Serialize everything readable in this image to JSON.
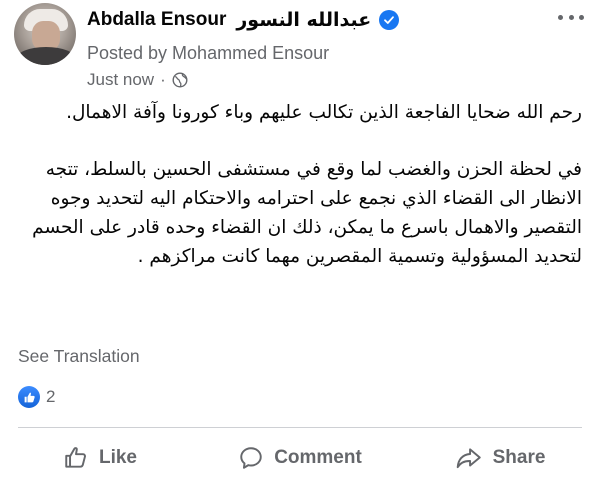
{
  "header": {
    "author_name": "Abdalla Ensour",
    "author_name_arabic": "عبدالله النسور",
    "posted_by": "Posted by Mohammed Ensour",
    "timestamp": "Just now",
    "separator": "·",
    "icons": {
      "verified": "verified-badge-icon",
      "more": "more-options-icon",
      "audience": "globe-icon"
    }
  },
  "post": {
    "paragraph1": "رحم الله ضحايا الفاجعة الذين تكالب عليهم وباء كورونا وآفة الاهمال.",
    "paragraph2": "في لحظة الحزن والغضب لما وقع في مستشفى الحسين بالسلط، تتجه الانظار الى القضاء الذي نجمع على احترامه والاحتكام اليه لتحديد وجوه التقصير والاهمال باسرع ما يمكن، ذلك ان القضاء وحده قادر على الحسم لتحديد المسؤولية وتسمية المقصرين مهما كانت مراكزهم ."
  },
  "see_translation": "See Translation",
  "reactions": {
    "count": "2",
    "icon": "like-reaction-icon"
  },
  "actions": {
    "like": "Like",
    "comment": "Comment",
    "share": "Share"
  },
  "colors": {
    "accent": "#1877f2",
    "secondary_text": "#65676b",
    "primary_text": "#050505",
    "divider": "#ced0d4"
  }
}
